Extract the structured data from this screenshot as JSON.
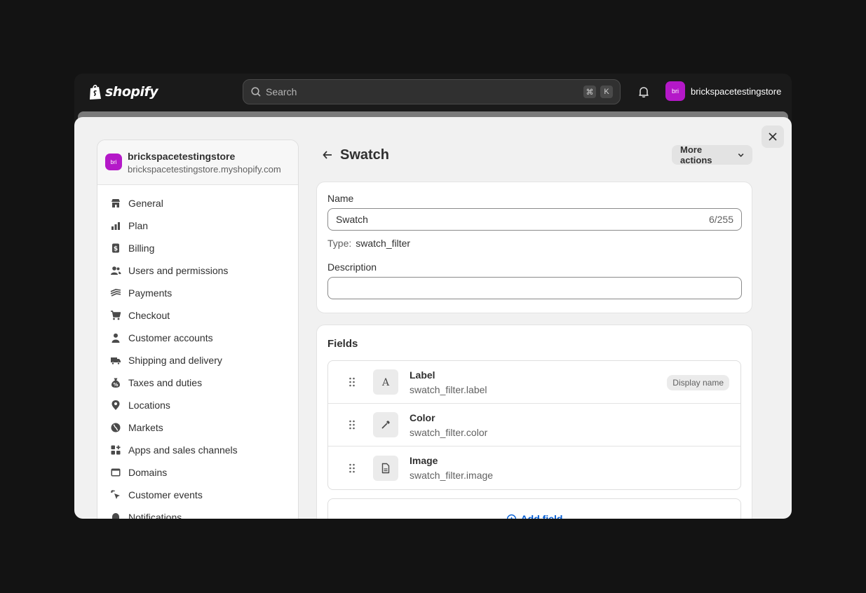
{
  "topbar": {
    "logo_text": "shopify",
    "search_placeholder": "Search",
    "shortcut_keys": [
      "⌘",
      "K"
    ],
    "account_avatar": "bri",
    "account_name": "brickspacetestingstore"
  },
  "sidebar": {
    "store_avatar": "bri",
    "store_name": "brickspacetestingstore",
    "store_url": "brickspacetestingstore.myshopify.com",
    "items": [
      {
        "label": "General",
        "icon": "store-icon"
      },
      {
        "label": "Plan",
        "icon": "plan-icon"
      },
      {
        "label": "Billing",
        "icon": "billing-icon"
      },
      {
        "label": "Users and permissions",
        "icon": "users-icon"
      },
      {
        "label": "Payments",
        "icon": "payments-icon"
      },
      {
        "label": "Checkout",
        "icon": "cart-icon"
      },
      {
        "label": "Customer accounts",
        "icon": "person-icon"
      },
      {
        "label": "Shipping and delivery",
        "icon": "truck-icon"
      },
      {
        "label": "Taxes and duties",
        "icon": "tax-icon"
      },
      {
        "label": "Locations",
        "icon": "location-icon"
      },
      {
        "label": "Markets",
        "icon": "globe-icon"
      },
      {
        "label": "Apps and sales channels",
        "icon": "apps-icon"
      },
      {
        "label": "Domains",
        "icon": "domain-icon"
      },
      {
        "label": "Customer events",
        "icon": "cursor-icon"
      },
      {
        "label": "Notifications",
        "icon": "bell-icon"
      }
    ]
  },
  "main": {
    "title": "Swatch",
    "more_actions_label": "More actions",
    "name_label": "Name",
    "name_value": "Swatch",
    "name_count": "6/255",
    "type_label": "Type:",
    "type_value": "swatch_filter",
    "description_label": "Description",
    "description_value": "",
    "fields_title": "Fields",
    "fields": [
      {
        "name": "Label",
        "key": "swatch_filter.label",
        "icon": "text-icon",
        "badge": "Display name"
      },
      {
        "name": "Color",
        "key": "swatch_filter.color",
        "icon": "eyedropper-icon",
        "badge": ""
      },
      {
        "name": "Image",
        "key": "swatch_filter.image",
        "icon": "file-icon",
        "badge": ""
      }
    ],
    "add_field_label": "Add field"
  }
}
